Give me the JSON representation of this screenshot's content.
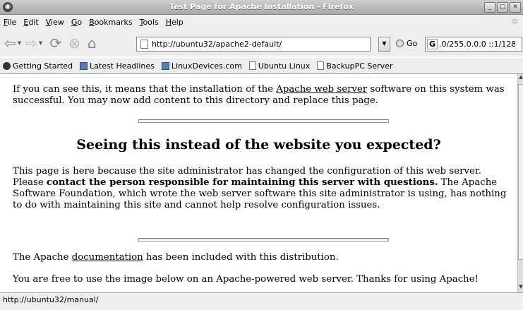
{
  "window": {
    "title": "Test Page for Apache Installation - Firefox"
  },
  "menu": [
    {
      "label": "File",
      "u": "F",
      "rest": "ile"
    },
    {
      "label": "Edit",
      "u": "E",
      "rest": "dit"
    },
    {
      "label": "View",
      "u": "V",
      "rest": "iew"
    },
    {
      "label": "Go",
      "u": "G",
      "rest": "o"
    },
    {
      "label": "Bookmarks",
      "u": "B",
      "rest": "ookmarks"
    },
    {
      "label": "Tools",
      "u": "T",
      "rest": "ools"
    },
    {
      "label": "Help",
      "u": "H",
      "rest": "elp"
    }
  ],
  "navbar": {
    "url": "http://ubuntu32/apache2-default/",
    "go_label": "Go",
    "search_value": ".0/255.0.0.0 ::1/128"
  },
  "bookmarks": [
    {
      "label": "Getting Started",
      "icon": "firefox-icon"
    },
    {
      "label": "Latest Headlines",
      "icon": "rss-icon"
    },
    {
      "label": "LinuxDevices.com",
      "icon": "rss-icon"
    },
    {
      "label": "Ubuntu Linux",
      "icon": "page-icon"
    },
    {
      "label": "BackupPC Server",
      "icon": "page-icon"
    }
  ],
  "content": {
    "intro_pre": "If you can see this, it means that the installation of the ",
    "intro_link": "Apache web server",
    "intro_post": " software on this system was successful. You may now add content to this directory and replace this page.",
    "heading": "Seeing this instead of the website you expected?",
    "para2_pre": "This page is here because the site administrator has changed the configuration of this web server. Please ",
    "para2_bold": "contact the person responsible for maintaining this server with questions.",
    "para2_post": " The Apache Software Foundation, which wrote the web server software this site administrator is using, has nothing to do with maintaining this site and cannot help resolve configuration issues.",
    "doc_pre": "The Apache ",
    "doc_link": "documentation",
    "doc_post": " has been included with this distribution.",
    "image_text": "You are free to use the image below on an Apache-powered web server. Thanks for using Apache!"
  },
  "status": {
    "text": "http://ubuntu32/manual/"
  }
}
